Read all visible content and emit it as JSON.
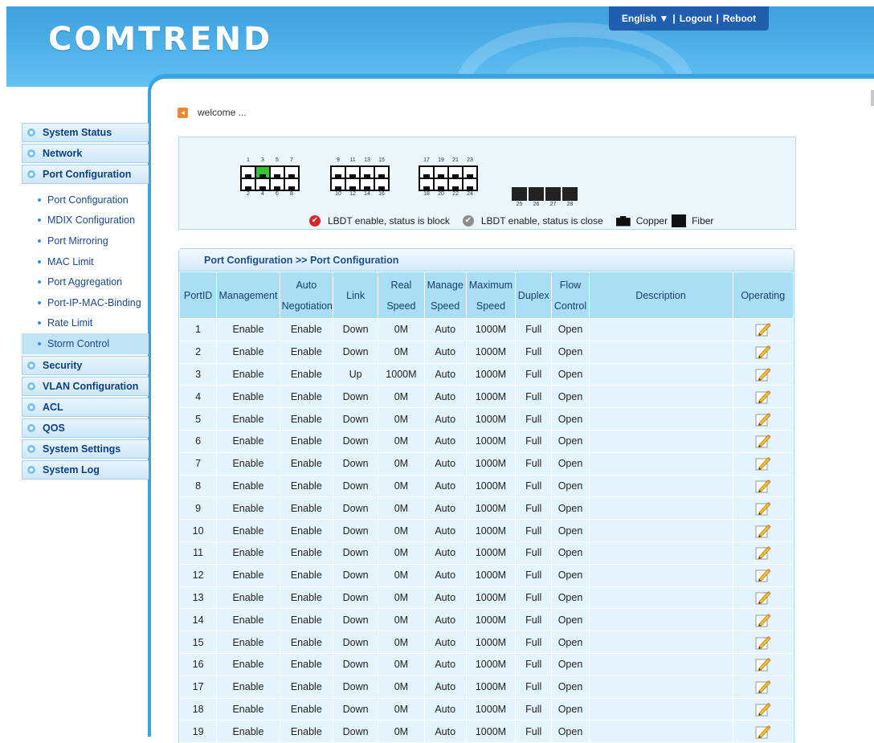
{
  "header": {
    "logo": "COMTREND",
    "top_links": [
      "English ▼",
      "Logout",
      "Reboot"
    ],
    "separator": "|"
  },
  "welcome_text": "welcome ...",
  "sidebar": {
    "items": [
      {
        "label": "System Status"
      },
      {
        "label": "Network"
      },
      {
        "label": "Port Configuration",
        "expanded": true
      }
    ],
    "sub_items": [
      {
        "label": "Port Configuration"
      },
      {
        "label": "MDIX Configuration"
      },
      {
        "label": "Port Mirroring"
      },
      {
        "label": "MAC Limit"
      },
      {
        "label": "Port Aggregation"
      },
      {
        "label": "Port-IP-MAC-Binding"
      },
      {
        "label": "Rate Limit"
      },
      {
        "label": "Storm Control",
        "active": true
      }
    ],
    "items_after": [
      {
        "label": "Security"
      },
      {
        "label": "VLAN Configuration"
      },
      {
        "label": "ACL"
      },
      {
        "label": "QOS"
      },
      {
        "label": "System Settings"
      },
      {
        "label": "System Log"
      }
    ]
  },
  "port_panel": {
    "top_numbers": [
      [
        "1",
        "3",
        "5",
        "7"
      ],
      [
        "9",
        "11",
        "13",
        "15"
      ],
      [
        "17",
        "19",
        "21",
        "23"
      ]
    ],
    "bottom_numbers": [
      [
        "2",
        "4",
        "6",
        "8"
      ],
      [
        "10",
        "12",
        "14",
        "16"
      ],
      [
        "18",
        "20",
        "22",
        "24"
      ]
    ],
    "fiber_numbers": [
      "25",
      "26",
      "27",
      "28"
    ],
    "up_port": "3",
    "legend": {
      "block": "LBDT enable, status is block",
      "close": "LBDT enable, status is close",
      "copper": "Copper",
      "fiber": "Fiber"
    }
  },
  "table": {
    "title": "Port Configuration >> Port Configuration",
    "headers": [
      "PortID",
      "Management",
      "Auto Negotiation",
      "Link",
      "Real Speed",
      "Manage Speed",
      "Maximum Speed",
      "Duplex",
      "Flow Control",
      "Description",
      "Operating"
    ],
    "rows": [
      [
        "1",
        "Enable",
        "Enable",
        "Down",
        "0M",
        "Auto",
        "1000M",
        "Full",
        "Open",
        ""
      ],
      [
        "2",
        "Enable",
        "Enable",
        "Down",
        "0M",
        "Auto",
        "1000M",
        "Full",
        "Open",
        ""
      ],
      [
        "3",
        "Enable",
        "Enable",
        "Up",
        "1000M",
        "Auto",
        "1000M",
        "Full",
        "Open",
        ""
      ],
      [
        "4",
        "Enable",
        "Enable",
        "Down",
        "0M",
        "Auto",
        "1000M",
        "Full",
        "Open",
        ""
      ],
      [
        "5",
        "Enable",
        "Enable",
        "Down",
        "0M",
        "Auto",
        "1000M",
        "Full",
        "Open",
        ""
      ],
      [
        "6",
        "Enable",
        "Enable",
        "Down",
        "0M",
        "Auto",
        "1000M",
        "Full",
        "Open",
        ""
      ],
      [
        "7",
        "Enable",
        "Enable",
        "Down",
        "0M",
        "Auto",
        "1000M",
        "Full",
        "Open",
        ""
      ],
      [
        "8",
        "Enable",
        "Enable",
        "Down",
        "0M",
        "Auto",
        "1000M",
        "Full",
        "Open",
        ""
      ],
      [
        "9",
        "Enable",
        "Enable",
        "Down",
        "0M",
        "Auto",
        "1000M",
        "Full",
        "Open",
        ""
      ],
      [
        "10",
        "Enable",
        "Enable",
        "Down",
        "0M",
        "Auto",
        "1000M",
        "Full",
        "Open",
        ""
      ],
      [
        "11",
        "Enable",
        "Enable",
        "Down",
        "0M",
        "Auto",
        "1000M",
        "Full",
        "Open",
        ""
      ],
      [
        "12",
        "Enable",
        "Enable",
        "Down",
        "0M",
        "Auto",
        "1000M",
        "Full",
        "Open",
        ""
      ],
      [
        "13",
        "Enable",
        "Enable",
        "Down",
        "0M",
        "Auto",
        "1000M",
        "Full",
        "Open",
        ""
      ],
      [
        "14",
        "Enable",
        "Enable",
        "Down",
        "0M",
        "Auto",
        "1000M",
        "Full",
        "Open",
        ""
      ],
      [
        "15",
        "Enable",
        "Enable",
        "Down",
        "0M",
        "Auto",
        "1000M",
        "Full",
        "Open",
        ""
      ],
      [
        "16",
        "Enable",
        "Enable",
        "Down",
        "0M",
        "Auto",
        "1000M",
        "Full",
        "Open",
        ""
      ],
      [
        "17",
        "Enable",
        "Enable",
        "Down",
        "0M",
        "Auto",
        "1000M",
        "Full",
        "Open",
        ""
      ],
      [
        "18",
        "Enable",
        "Enable",
        "Down",
        "0M",
        "Auto",
        "1000M",
        "Full",
        "Open",
        ""
      ],
      [
        "19",
        "Enable",
        "Enable",
        "Down",
        "0M",
        "Auto",
        "1000M",
        "Full",
        "Open",
        ""
      ]
    ],
    "operating_icon": "edit-pencil-icon"
  },
  "colors": {
    "header_blue": "#3e9fdc",
    "topbar": "#1f5fae",
    "table_header": "#a8dff4",
    "row_bg": "#e4f4fc",
    "port_up": "#33c43c",
    "menu_text": "#0b3f86"
  }
}
